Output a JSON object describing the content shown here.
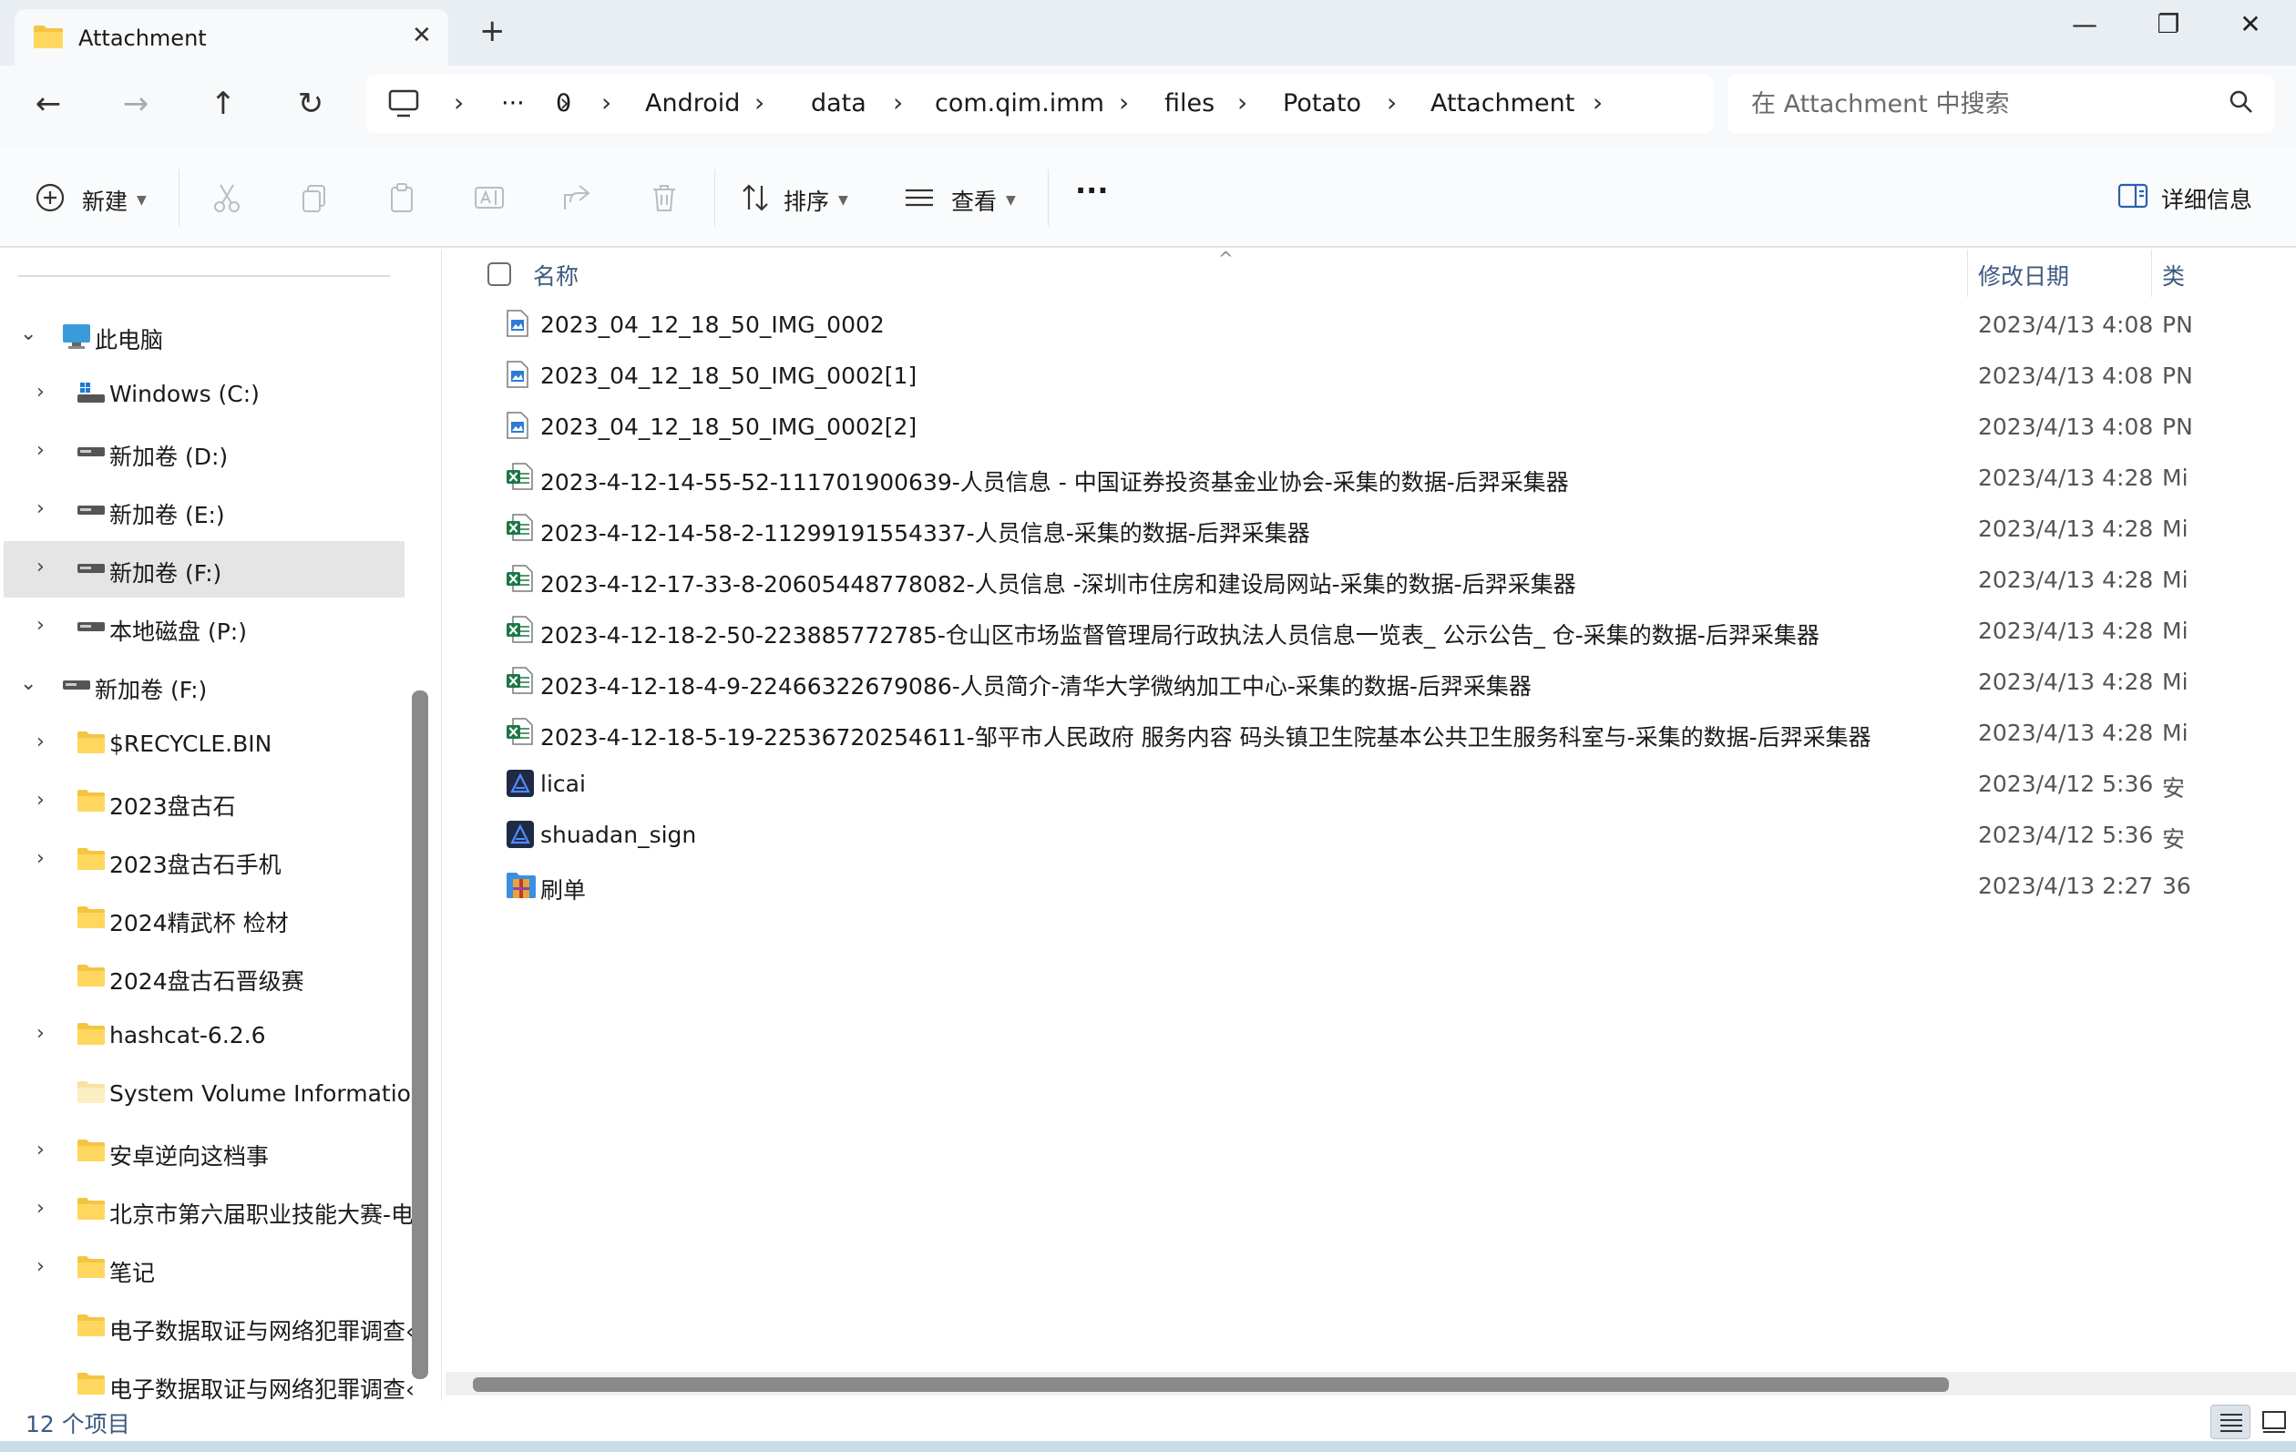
{
  "window": {
    "tab_title": "Attachment",
    "new_tab": "+",
    "minimize": "—",
    "maximize": "❐",
    "close": "✕"
  },
  "nav": {
    "back": "←",
    "forward": "→",
    "up": "↑",
    "refresh": "↻"
  },
  "breadcrumb": {
    "more": "···",
    "items": [
      "0",
      "Android",
      "data",
      "com.qim.imm",
      "files",
      "Potato",
      "Attachment"
    ]
  },
  "search": {
    "placeholder": "在 Attachment 中搜索"
  },
  "toolbar": {
    "new_label": "新建",
    "sort_label": "排序",
    "view_label": "查看",
    "more_label": "···",
    "details_label": "详细信息"
  },
  "sidebar": {
    "items": [
      {
        "label": "此电脑",
        "expanded": true
      },
      {
        "label": "Windows (C:)"
      },
      {
        "label": "新加卷 (D:)"
      },
      {
        "label": "新加卷 (E:)"
      },
      {
        "label": "新加卷 (F:)",
        "selected": true
      },
      {
        "label": "本地磁盘 (P:)"
      },
      {
        "label": "新加卷 (F:)",
        "expanded": true
      },
      {
        "label": "$RECYCLE.BIN"
      },
      {
        "label": "2023盘古石"
      },
      {
        "label": "2023盘古石手机"
      },
      {
        "label": "2024精武杯 检材"
      },
      {
        "label": "2024盘古石晋级赛"
      },
      {
        "label": "hashcat-6.2.6"
      },
      {
        "label": "System Volume Information"
      },
      {
        "label": "安卓逆向这档事"
      },
      {
        "label": "北京市第六届职业技能大赛-电"
      },
      {
        "label": "笔记"
      },
      {
        "label": "电子数据取证与网络犯罪调查‹"
      },
      {
        "label": "电子数据取证与网络犯罪调查‹"
      }
    ]
  },
  "columns": {
    "name": "名称",
    "modified": "修改日期",
    "type": "类"
  },
  "files": [
    {
      "name": "2023_04_12_18_50_IMG_0002",
      "date": "2023/4/13 4:08",
      "type": "PN",
      "icon": "image-file-icon"
    },
    {
      "name": "2023_04_12_18_50_IMG_0002[1]",
      "date": "2023/4/13 4:08",
      "type": "PN",
      "icon": "image-file-icon"
    },
    {
      "name": "2023_04_12_18_50_IMG_0002[2]",
      "date": "2023/4/13 4:08",
      "type": "PN",
      "icon": "image-file-icon"
    },
    {
      "name": "2023-4-12-14-55-52-111701900639-人员信息 - 中国证券投资基金业协会-采集的数据-后羿采集器",
      "date": "2023/4/13 4:28",
      "type": "Mi",
      "icon": "excel-file-icon"
    },
    {
      "name": "2023-4-12-14-58-2-11299191554337-人员信息-采集的数据-后羿采集器",
      "date": "2023/4/13 4:28",
      "type": "Mi",
      "icon": "excel-file-icon"
    },
    {
      "name": "2023-4-12-17-33-8-20605448778082-人员信息 -深圳市住房和建设局网站-采集的数据-后羿采集器",
      "date": "2023/4/13 4:28",
      "type": "Mi",
      "icon": "excel-file-icon"
    },
    {
      "name": "2023-4-12-18-2-50-223885772785-仓山区市场监督管理局行政执法人员信息一览表_ 公示公告_ 仓-采集的数据-后羿采集器",
      "date": "2023/4/13 4:28",
      "type": "Mi",
      "icon": "excel-file-icon"
    },
    {
      "name": "2023-4-12-18-4-9-22466322679086-人员简介-清华大学微纳加工中心-采集的数据-后羿采集器",
      "date": "2023/4/13 4:28",
      "type": "Mi",
      "icon": "excel-file-icon"
    },
    {
      "name": "2023-4-12-18-5-19-22536720254611-邹平市人民政府 服务内容 码头镇卫生院基本公共卫生服务科室与-采集的数据-后羿采集器",
      "date": "2023/4/13 4:28",
      "type": "Mi",
      "icon": "excel-file-icon"
    },
    {
      "name": "licai",
      "date": "2023/4/12 5:36",
      "type": "安",
      "icon": "apk-file-icon"
    },
    {
      "name": "shuadan_sign",
      "date": "2023/4/12 5:36",
      "type": "安",
      "icon": "apk-file-icon"
    },
    {
      "name": "刷单",
      "date": "2023/4/13 2:27",
      "type": "36",
      "icon": "archive-file-icon"
    }
  ],
  "status": {
    "count": "12 个项目"
  }
}
